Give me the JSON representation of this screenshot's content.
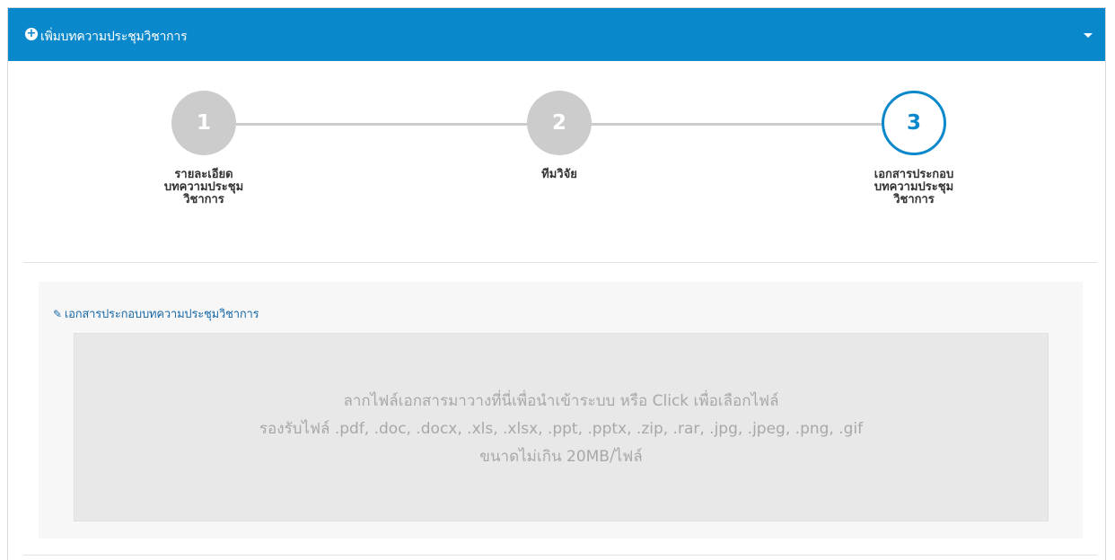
{
  "header": {
    "title": "เพิ่มบทความประชุมวิชาการ",
    "plus_icon": "plus-circle-icon",
    "caret_icon": "caret-down-icon",
    "accent": "#0a88cc"
  },
  "steps": [
    {
      "number": "1",
      "label": "รายละเอียด\nบทความประชุม\nวิชาการ",
      "state": "done"
    },
    {
      "number": "2",
      "label": "ทีมวิจัย",
      "state": "done"
    },
    {
      "number": "3",
      "label": "เอกสารประกอบ\nบทความประชุม\nวิชาการ",
      "state": "active"
    }
  ],
  "upload": {
    "heading": "เอกสารประกอบบทความประชุมวิชาการ",
    "heading_icon": "paperclip-icon",
    "line1": "ลากไฟล์เอกสารมาวางที่นี่เพื่อนำเข้าระบบ หรือ Click เพื่อเลือกไฟล์",
    "line2": "รองรับไฟล์ .pdf, .doc, .docx, .xls, .xlsx, .ppt, .pptx, .zip, .rar, .jpg, .jpeg, .png, .gif",
    "line3": "ขนาดไม่เกิน 20MB/ไฟล์"
  }
}
